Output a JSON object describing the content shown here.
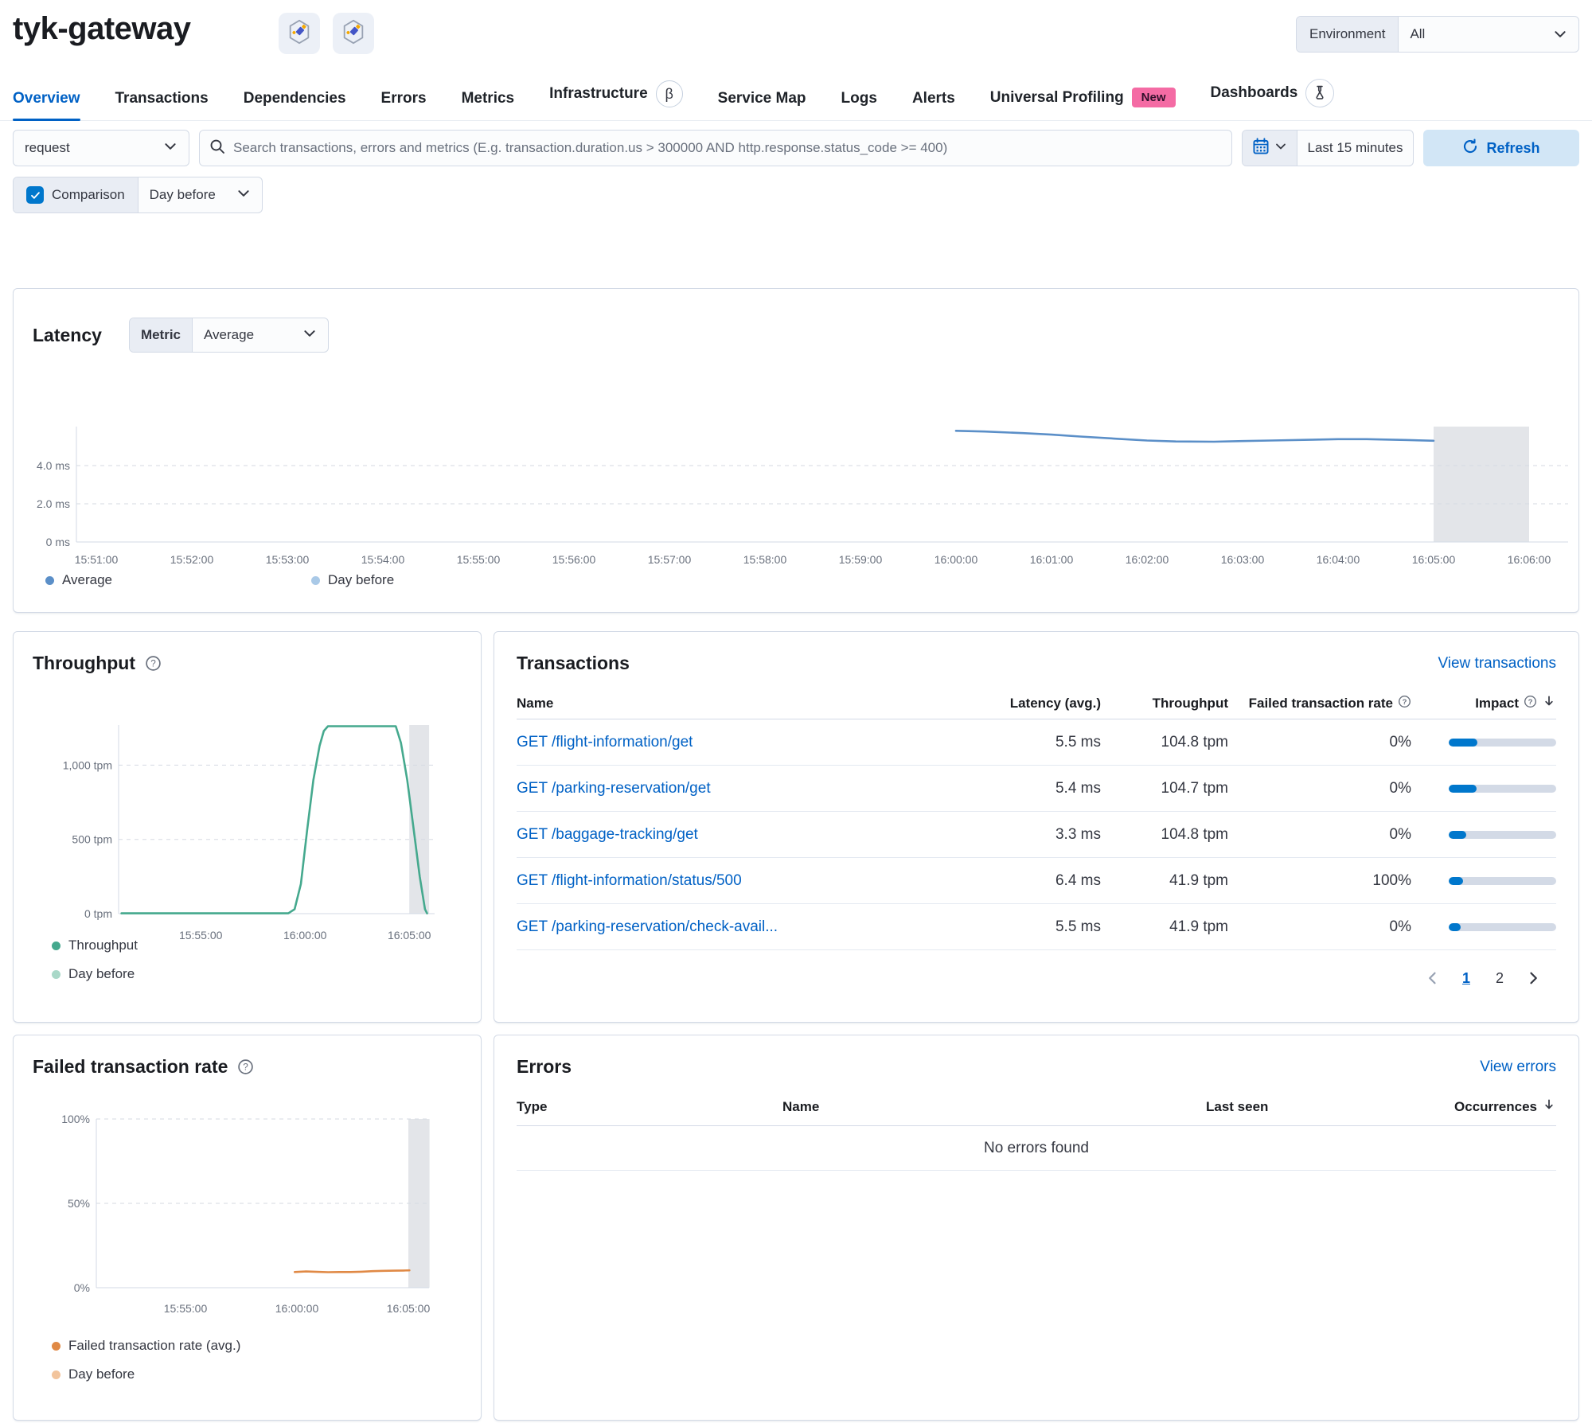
{
  "header": {
    "title": "tyk-gateway",
    "environment_label": "Environment",
    "environment_value": "All"
  },
  "nav": {
    "tabs": [
      {
        "label": "Overview",
        "active": true
      },
      {
        "label": "Transactions"
      },
      {
        "label": "Dependencies"
      },
      {
        "label": "Errors"
      },
      {
        "label": "Metrics"
      },
      {
        "label": "Infrastructure",
        "beta": "β"
      },
      {
        "label": "Service Map"
      },
      {
        "label": "Logs"
      },
      {
        "label": "Alerts"
      },
      {
        "label": "Universal Profiling",
        "badge": "New"
      },
      {
        "label": "Dashboards",
        "icon": "beaker"
      }
    ]
  },
  "filters": {
    "transaction_type_value": "request",
    "search_placeholder": "Search transactions, errors and metrics (E.g. transaction.duration.us > 300000 AND http.response.status_code >= 400)",
    "time_range_value": "Last 15 minutes",
    "refresh_label": "Refresh",
    "comparison_label": "Comparison",
    "comparison_value": "Day before",
    "comparison_checked": true
  },
  "latency_panel": {
    "title": "Latency",
    "metric_label": "Metric",
    "metric_value": "Average",
    "legend": [
      {
        "label": "Average",
        "color": "#5B8FC8"
      },
      {
        "label": "Day before",
        "color": "#A9C9E7"
      }
    ]
  },
  "throughput_panel": {
    "title": "Throughput",
    "legend": [
      {
        "label": "Throughput",
        "color": "#45A98E"
      },
      {
        "label": "Day before",
        "color": "#A9D8C8"
      }
    ]
  },
  "transactions_panel": {
    "title": "Transactions",
    "view_link": "View transactions",
    "columns": {
      "name": "Name",
      "latency": "Latency (avg.)",
      "throughput": "Throughput",
      "failed_rate": "Failed transaction rate",
      "impact": "Impact"
    },
    "rows": [
      {
        "name": "GET /flight-information/get",
        "latency": "5.5 ms",
        "throughput": "104.8 tpm",
        "failed_rate": "0%",
        "impact_pct": 27
      },
      {
        "name": "GET /parking-reservation/get",
        "latency": "5.4 ms",
        "throughput": "104.7 tpm",
        "failed_rate": "0%",
        "impact_pct": 26
      },
      {
        "name": "GET /baggage-tracking/get",
        "latency": "3.3 ms",
        "throughput": "104.8 tpm",
        "failed_rate": "0%",
        "impact_pct": 16
      },
      {
        "name": "GET /flight-information/status/500",
        "latency": "6.4 ms",
        "throughput": "41.9 tpm",
        "failed_rate": "100%",
        "impact_pct": 13
      },
      {
        "name": "GET /parking-reservation/check-avail...",
        "latency": "5.5 ms",
        "throughput": "41.9 tpm",
        "failed_rate": "0%",
        "impact_pct": 11
      }
    ],
    "pagination": {
      "pages": [
        "1",
        "2"
      ],
      "active": "1"
    }
  },
  "failed_rate_panel": {
    "title": "Failed transaction rate",
    "legend": [
      {
        "label": "Failed transaction rate (avg.)",
        "color": "#E08945"
      },
      {
        "label": "Day before",
        "color": "#F2C49C"
      }
    ]
  },
  "errors_panel": {
    "title": "Errors",
    "view_link": "View errors",
    "columns": {
      "type": "Type",
      "name": "Name",
      "last_seen": "Last seen",
      "occurrences": "Occurrences"
    },
    "empty_message": "No errors found"
  },
  "chart_data": [
    {
      "type": "line",
      "title": "Latency",
      "x_unit": "minutes since 15:51:00",
      "xlim": [
        0,
        15.3
      ],
      "ylim": [
        0,
        6.04
      ],
      "grid": "dashed",
      "x_ticks": [
        {
          "t": 0,
          "label": "15:51:00"
        },
        {
          "t": 1,
          "label": "15:52:00"
        },
        {
          "t": 2,
          "label": "15:53:00"
        },
        {
          "t": 3,
          "label": "15:54:00"
        },
        {
          "t": 4,
          "label": "15:55:00"
        },
        {
          "t": 5,
          "label": "15:56:00"
        },
        {
          "t": 6,
          "label": "15:57:00"
        },
        {
          "t": 7,
          "label": "15:58:00"
        },
        {
          "t": 8,
          "label": "15:59:00"
        },
        {
          "t": 9,
          "label": "16:00:00"
        },
        {
          "t": 10,
          "label": "16:01:00"
        },
        {
          "t": 11,
          "label": "16:02:00"
        },
        {
          "t": 12,
          "label": "16:03:00"
        },
        {
          "t": 13,
          "label": "16:04:00"
        },
        {
          "t": 14,
          "label": "16:05:00"
        },
        {
          "t": 15,
          "label": "16:06:00"
        }
      ],
      "y_gridlines": [
        {
          "v": 0,
          "label": "0 ms"
        },
        {
          "v": 2,
          "label": "2.0 ms"
        },
        {
          "v": 4,
          "label": "4.0 ms"
        }
      ],
      "series": [
        {
          "name": "Average",
          "color": "#5B8FC8",
          "points": [
            [
              9,
              5.82
            ],
            [
              9.3,
              5.78
            ],
            [
              9.7,
              5.7
            ],
            [
              10,
              5.62
            ],
            [
              10.3,
              5.52
            ],
            [
              10.7,
              5.4
            ],
            [
              11,
              5.31
            ],
            [
              11.3,
              5.26
            ],
            [
              11.7,
              5.25
            ],
            [
              12,
              5.28
            ],
            [
              12.3,
              5.31
            ],
            [
              12.7,
              5.35
            ],
            [
              13,
              5.38
            ],
            [
              13.3,
              5.38
            ],
            [
              13.7,
              5.34
            ],
            [
              14,
              5.3
            ]
          ]
        },
        {
          "name": "Day before",
          "color": "#A9C9E7",
          "points": []
        }
      ],
      "annotation_band": {
        "t0": 14,
        "t1": 15
      }
    },
    {
      "type": "line",
      "title": "Throughput",
      "x_unit": "minutes since 15:51:00",
      "xlim": [
        0,
        15.2
      ],
      "ylim": [
        0,
        1270
      ],
      "grid": "dashed",
      "x_ticks": [
        {
          "t": 4,
          "label": "15:55:00"
        },
        {
          "t": 9,
          "label": "16:00:00"
        },
        {
          "t": 14,
          "label": "16:05:00"
        }
      ],
      "y_gridlines": [
        {
          "v": 0,
          "label": "0 tpm"
        },
        {
          "v": 500,
          "label": "500 tpm"
        },
        {
          "v": 1000,
          "label": "1,000 tpm"
        }
      ],
      "series": [
        {
          "name": "Throughput",
          "color": "#45A98E",
          "points": [
            [
              0.2,
              2
            ],
            [
              8.2,
              2
            ],
            [
              8.5,
              30
            ],
            [
              8.8,
              200
            ],
            [
              9.1,
              560
            ],
            [
              9.4,
              900
            ],
            [
              9.7,
              1130
            ],
            [
              9.9,
              1230
            ],
            [
              10.1,
              1262
            ],
            [
              13.35,
              1262
            ],
            [
              13.6,
              1150
            ],
            [
              13.9,
              900
            ],
            [
              14.2,
              580
            ],
            [
              14.5,
              250
            ],
            [
              14.75,
              30
            ],
            [
              14.85,
              2
            ]
          ]
        },
        {
          "name": "Day before",
          "color": "#A9D8C8",
          "points": []
        }
      ],
      "annotation_band": {
        "t0": 14,
        "t1": 14.95
      }
    },
    {
      "type": "line",
      "title": "Failed transaction rate",
      "x_unit": "minutes since 15:51:00",
      "xlim": [
        0,
        15
      ],
      "ylim": [
        0,
        100
      ],
      "grid": "dashed",
      "x_ticks": [
        {
          "t": 4,
          "label": "15:55:00"
        },
        {
          "t": 9,
          "label": "16:00:00"
        },
        {
          "t": 14,
          "label": "16:05:00"
        }
      ],
      "y_gridlines": [
        {
          "v": 0,
          "label": "0%"
        },
        {
          "v": 50,
          "label": "50%"
        },
        {
          "v": 100,
          "label": "100%"
        }
      ],
      "series": [
        {
          "name": "Failed transaction rate (avg.)",
          "color": "#E08945",
          "points": [
            [
              8.9,
              9.3
            ],
            [
              9.4,
              9.6
            ],
            [
              9.9,
              9.4
            ],
            [
              10.4,
              9.2
            ],
            [
              10.9,
              9.3
            ],
            [
              11.4,
              9.3
            ],
            [
              11.9,
              9.5
            ],
            [
              12.4,
              9.8
            ],
            [
              12.9,
              10
            ],
            [
              13.4,
              10.1
            ],
            [
              13.8,
              10.2
            ],
            [
              14.05,
              10.3
            ]
          ]
        },
        {
          "name": "Day before",
          "color": "#F2C49C",
          "points": []
        }
      ],
      "annotation_band": {
        "t0": 14,
        "t1": 14.95
      }
    }
  ]
}
